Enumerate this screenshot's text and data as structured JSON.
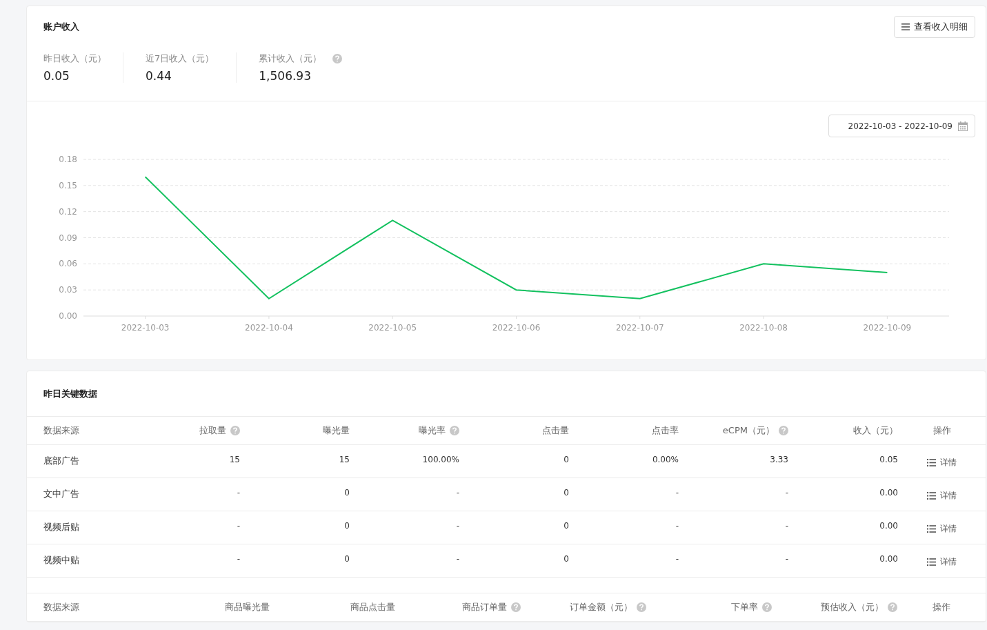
{
  "income_card": {
    "title": "账户收入",
    "detail_button": {
      "label": "查看收入明细"
    },
    "stats": [
      {
        "label": "昨日收入（元）",
        "value": "0.05",
        "help": false
      },
      {
        "label": "近7日收入（元）",
        "value": "0.44",
        "help": false
      },
      {
        "label": "累计收入（元）",
        "value": "1,506.93",
        "help": true
      }
    ],
    "date_range": {
      "value": "2022-10-03 - 2022-10-09"
    },
    "chart_data": {
      "type": "line",
      "categories": [
        "2022-10-03",
        "2022-10-04",
        "2022-10-05",
        "2022-10-06",
        "2022-10-07",
        "2022-10-08",
        "2022-10-09"
      ],
      "series": [
        {
          "color": "#13c15f",
          "values": [
            0.16,
            0.02,
            0.11,
            0.03,
            0.02,
            0.06,
            0.05
          ]
        }
      ],
      "ylim": [
        0,
        0.18
      ],
      "grid": true,
      "yticks": [
        {
          "value": 0,
          "label": "0.00"
        },
        {
          "value": 0.03,
          "label": "0.03"
        },
        {
          "value": 0.06,
          "label": "0.06"
        },
        {
          "value": 0.09,
          "label": "0.09"
        },
        {
          "value": 0.12,
          "label": "0.12"
        },
        {
          "value": 0.15,
          "label": "0.15"
        },
        {
          "value": 0.18,
          "label": "0.18"
        }
      ]
    }
  },
  "key_data_card": {
    "title": "昨日关键数据",
    "ad_table": {
      "columns": [
        {
          "label": "数据来源",
          "help": false
        },
        {
          "label": "拉取量",
          "help": true
        },
        {
          "label": "曝光量",
          "help": false
        },
        {
          "label": "曝光率",
          "help": true
        },
        {
          "label": "点击量",
          "help": false
        },
        {
          "label": "点击率",
          "help": false
        },
        {
          "label": "eCPM（元）",
          "help": true
        },
        {
          "label": "收入（元）",
          "help": false
        },
        {
          "label": "操作",
          "help": false
        }
      ],
      "rows": [
        {
          "cells": [
            "底部广告",
            "15",
            "15",
            "100.00%",
            "0",
            "0.00%",
            "3.33",
            "0.05"
          ],
          "action": "详情"
        },
        {
          "cells": [
            "文中广告",
            "-",
            "0",
            "-",
            "0",
            "-",
            "-",
            "0.00"
          ],
          "action": "详情"
        },
        {
          "cells": [
            "视频后贴",
            "-",
            "0",
            "-",
            "0",
            "-",
            "-",
            "0.00"
          ],
          "action": "详情"
        },
        {
          "cells": [
            "视频中贴",
            "-",
            "0",
            "-",
            "0",
            "-",
            "-",
            "0.00"
          ],
          "action": "详情"
        }
      ]
    },
    "goods_table": {
      "columns": [
        {
          "label": "数据来源",
          "help": false
        },
        {
          "label": "商品曝光量",
          "help": false
        },
        {
          "label": "商品点击量",
          "help": false
        },
        {
          "label": "商品订单量",
          "help": true
        },
        {
          "label": "订单金额（元）",
          "help": true
        },
        {
          "label": "下单率",
          "help": true
        },
        {
          "label": "预估收入（元）",
          "help": true
        },
        {
          "label": "操作",
          "help": false
        }
      ]
    }
  }
}
